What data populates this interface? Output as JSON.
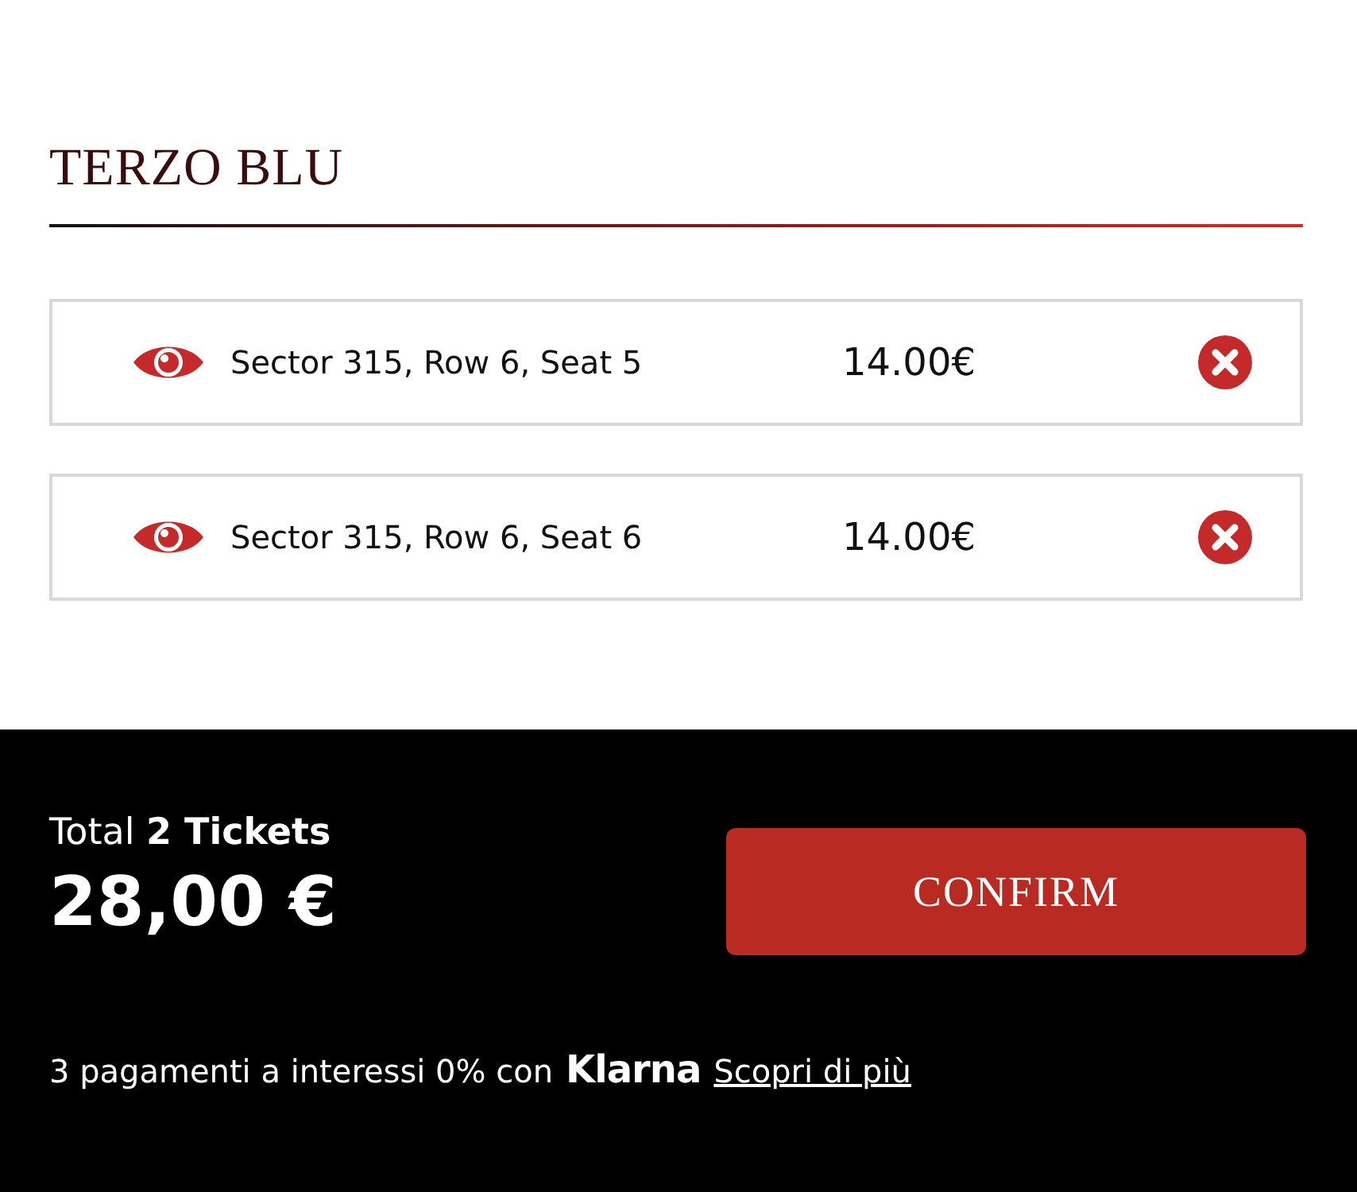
{
  "section": {
    "title": "TERZO BLU"
  },
  "tickets": [
    {
      "seat": "Sector 315, Row 6, Seat 5",
      "price": "14.00€"
    },
    {
      "seat": "Sector 315, Row 6, Seat 6",
      "price": "14.00€"
    }
  ],
  "footer": {
    "total_label": "Total **2 Tickets**",
    "total": "28,00 €",
    "confirm": "CONFIRM",
    "installments": "3 pagamenti a interessi 0% con",
    "klarna": "Klarna",
    "learn_more": "Scopri di più"
  }
}
